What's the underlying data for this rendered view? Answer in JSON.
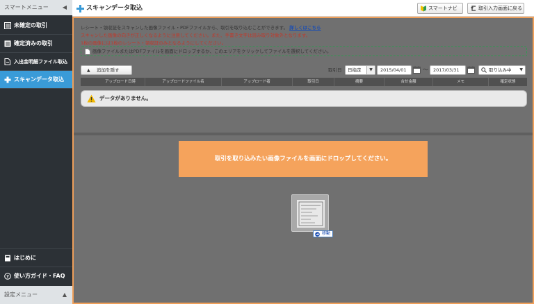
{
  "sidebar": {
    "header_label": "スマートメニュー",
    "items": [
      {
        "label": "未確定の取引"
      },
      {
        "label": "確定済みの取引"
      },
      {
        "label": "入出金明細ファイル取込"
      },
      {
        "label": "スキャンデータ取込"
      }
    ],
    "bottom_items": [
      {
        "label": "はじめに"
      },
      {
        "label": "使い方ガイド・FAQ"
      }
    ],
    "footer_label": "設定メニュー"
  },
  "header": {
    "title": "スキャンデータ取込",
    "smart_navi_label": "スマートナビ",
    "back_label": "取引入力画面に戻る"
  },
  "notice": {
    "line1": "レシート・領収証をスキャンした画像ファイル・PDFファイルから、取引を取り込むことができます。",
    "line1_link": "詳しくはこちら",
    "line2": "スキャンした画像の向きが正しくなるように注意してください。また、手書き文字は読み取り対象外となります。",
    "line3": "1枚の画像には1枚のレシート・領収証のみとなるようにしてください。"
  },
  "dropzone_text": "画像ファイルまたはPDFファイルを画面にドロップするか、このエリアをクリックしてファイルを選択してください。",
  "filters": {
    "collapse_label": "追加を隠す",
    "date_label": "取引日",
    "period_selected": "日指定",
    "date_from": "2015/04/01",
    "date_to": "2017/03/31",
    "status_selected": "取り込み中"
  },
  "table": {
    "columns": [
      "アップロード日時",
      "アップロードファイル名",
      "アップロード者",
      "取引日",
      "摘要",
      "合計金額",
      "メモ",
      "確定状態"
    ],
    "empty_message": "データがありません。"
  },
  "drop_overlay": {
    "message": "取引を取り込みたい画像ファイルを画面にドロップしてください。",
    "move_label": "移動"
  },
  "colors": {
    "accent_orange": "#f5a35c",
    "active_blue": "#3a9bd8",
    "sidebar_bg": "#2c3136",
    "warning_red": "#c0392b"
  }
}
